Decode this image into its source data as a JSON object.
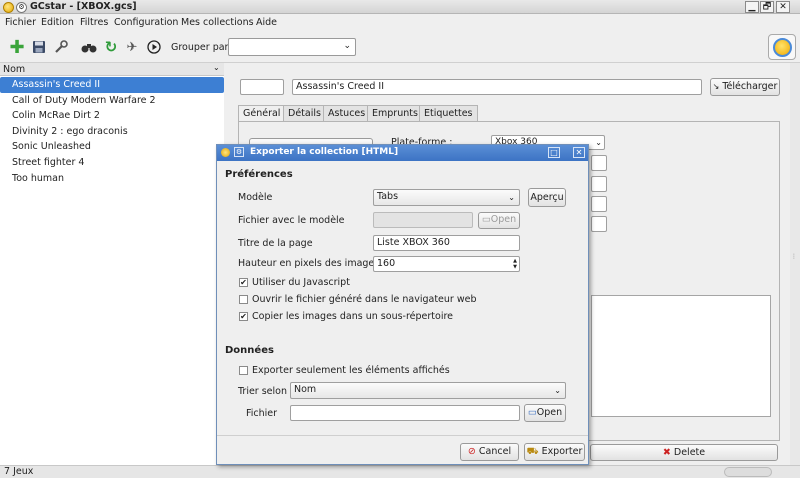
{
  "window": {
    "title": "GCstar - [XBOX.gcs]",
    "min_glyph": "▁",
    "max_glyph": "🗗",
    "close_glyph": "✕"
  },
  "menubar": {
    "items": [
      "Fichier",
      "Edition",
      "Filtres",
      "Configuration",
      "Mes collections",
      "Aide"
    ]
  },
  "toolbar": {
    "icons": [
      "add-icon",
      "save-icon",
      "settings-wrench-icon",
      "binoculars-search-icon",
      "refresh-icon",
      "plane-icon",
      "play-icon"
    ],
    "group_by_label": "Grouper par",
    "group_by_value": ""
  },
  "list": {
    "header": "Nom",
    "items": [
      "Assassin's Creed II",
      "Call of Duty Modern Warfare 2",
      "Colin McRae Dirt 2",
      "Divinity 2 : ego draconis",
      "Sonic Unleashed",
      "Street fighter 4",
      "Too human"
    ],
    "selected_index": 0
  },
  "status": {
    "count_text": "7 Jeux"
  },
  "detail": {
    "id_value": "",
    "title_value": "Assassin's Creed II",
    "download_label": "Télécharger",
    "tabs": [
      "Général",
      "Détails",
      "Astuces",
      "Emprunts",
      "Etiquettes"
    ],
    "active_tab": 0,
    "platform_label": "Plate-forme :",
    "platform_value": "Xbox 360",
    "delete_label": "Delete"
  },
  "dialog": {
    "title": "Exporter la collection [HTML]",
    "prefs_heading": "Préférences",
    "model_label": "Modèle",
    "model_value": "Tabs",
    "preview_label": "Aperçu",
    "template_file_label": "Fichier avec le modèle",
    "template_file_value": "",
    "open_label": "Open",
    "page_title_label": "Titre de la page",
    "page_title_value": "Liste XBOX 360",
    "image_height_label": "Hauteur en pixels des images",
    "image_height_value": "160",
    "checkbox_js_label": "Utiliser du Javascript",
    "checkbox_js_checked": true,
    "checkbox_open_label": "Ouvrir le fichier généré dans le navigateur web",
    "checkbox_open_checked": false,
    "checkbox_copy_label": "Copier les images dans un sous-répertoire",
    "checkbox_copy_checked": true,
    "data_heading": "Données",
    "checkbox_visible_label": "Exporter seulement les éléments affichés",
    "checkbox_visible_checked": false,
    "sort_label": "Trier selon",
    "sort_value": "Nom",
    "file_label": "Fichier",
    "file_value": "",
    "file_open_label": "Open",
    "cancel_label": "Cancel",
    "export_label": "Exporter"
  },
  "colors": {
    "selection": "#3d7fd3",
    "dialog_title": "#3c73c4"
  }
}
